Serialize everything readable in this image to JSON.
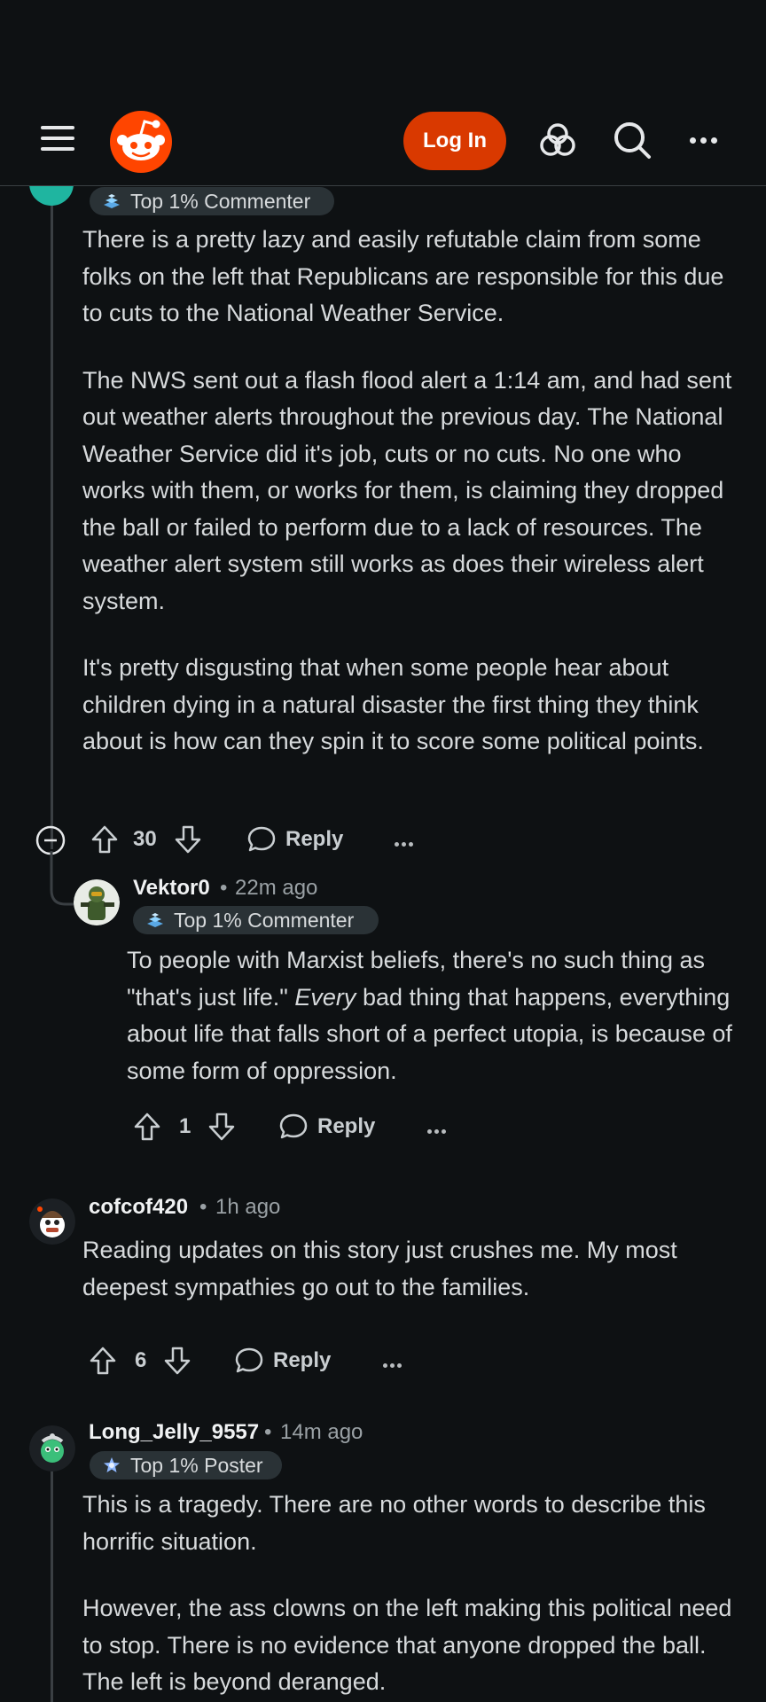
{
  "header": {
    "login_label": "Log In"
  },
  "comments": [
    {
      "badge": "Top 1% Commenter",
      "paragraphs": [
        "There is a pretty lazy and easily refutable claim from some folks on the left that Republicans are responsible for this due to cuts to the National Weather Service.",
        "The NWS sent out a flash flood alert a 1:14 am, and had sent out weather alerts throughout the previous day. The National Weather Service did it's job, cuts or no cuts. No one who works with them, or works for them, is claiming they dropped the ball or failed to perform due to a lack of resources. The weather alert system still works as does their wireless alert system.",
        "It's pretty disgusting that when some people hear about children dying in a natural disaster the first thing they think about is how can they spin it to score some political points."
      ],
      "votes": "30",
      "reply_label": "Reply"
    },
    {
      "username": "Vektor0",
      "time": "22m ago",
      "badge": "Top 1% Commenter",
      "text_before": "To people with Marxist beliefs, there's no such thing as \"that's just life.\" ",
      "text_emph": "Every",
      "text_after": " bad thing that happens, everything about life that falls short of a perfect utopia, is because of some form of oppression.",
      "votes": "1",
      "reply_label": "Reply"
    },
    {
      "username": "cofcof420",
      "time": "1h ago",
      "paragraphs": [
        "Reading updates on this story just crushes me. My most deepest sympathies go out to the families."
      ],
      "votes": "6",
      "reply_label": "Reply"
    },
    {
      "username": "Long_Jelly_9557",
      "time": "14m ago",
      "badge": "Top 1% Poster",
      "paragraphs": [
        "This is a tragedy. There are no other words to describe this horrific situation.",
        "However, the ass clowns on the left making this political need to stop. There is no evidence that anyone dropped the ball. The left is beyond deranged."
      ]
    }
  ],
  "separator": "•",
  "colors": {
    "accent": "#d93900",
    "background": "#0e1113",
    "badge_bg": "#2a3236",
    "text": "#d7dadc"
  },
  "icons": [
    "menu-icon",
    "reddit-logo-icon",
    "advertise-icon",
    "search-icon",
    "more-icon",
    "collapse-icon",
    "upvote-icon",
    "downvote-icon",
    "comment-icon"
  ]
}
